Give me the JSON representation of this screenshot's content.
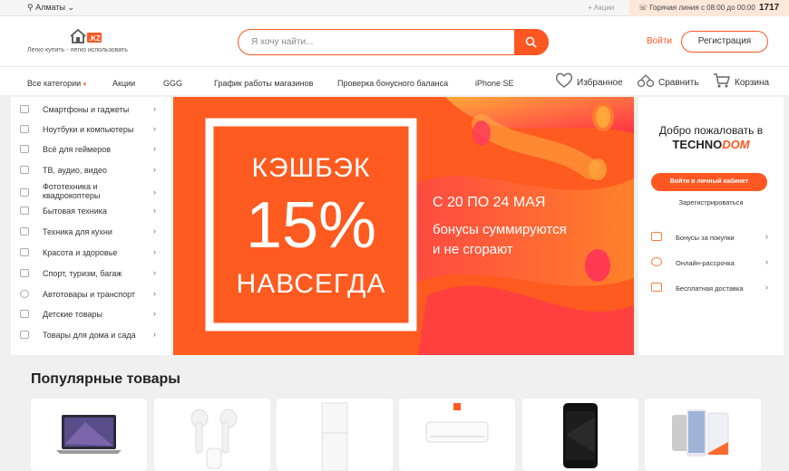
{
  "topbar": {
    "city": "Алматы",
    "promo_link": "+ Акции",
    "hotline_label": "Горячая линия с 08:00 до 00:00",
    "hotline_number": "1717"
  },
  "header": {
    "slogan": "Легко купить - легко использовать",
    "search_placeholder": "Я хочу найти...",
    "login": "Войти",
    "register": "Регистрация"
  },
  "nav": {
    "all_categories": "Все категории",
    "links": [
      "Акции",
      "GGG",
      "График работы магазинов",
      "Проверка бонусного баланса",
      "iPhone SE"
    ],
    "favorites": "Избранное",
    "compare": "Сравнить",
    "cart": "Корзина"
  },
  "sidebar": {
    "items": [
      "Смартфоны и гаджеты",
      "Ноутбуки и компьютеры",
      "Всё для геймеров",
      "ТВ, аудио, видео",
      "Фототехника и квадрокоптеры",
      "Бытовая техника",
      "Техника для кухни",
      "Красота и здоровье",
      "Спорт, туризм, багаж",
      "Автотовары и транспорт",
      "Детские товары",
      "Товары для дома и сада"
    ]
  },
  "banner": {
    "line1": "КЭШБЭК",
    "line2": "15%",
    "line3": "НАВСЕГДА",
    "dates": "С 20 ПО 24 МАЯ",
    "sub1": "бонусы суммируются",
    "sub2": "и не сгорают"
  },
  "welcome": {
    "title": "Добро пожаловать в",
    "brand_a": "TECHNO",
    "brand_b": "DOM",
    "cabinet_button": "Войти в личный кабинет",
    "register_link": "Зарегистрироваться",
    "benefits": [
      "Бонусы за покупки",
      "Онлайн-рассрочка",
      "Бесплатная доставка"
    ]
  },
  "popular": {
    "title": "Популярные товары"
  },
  "colors": {
    "accent": "#ff5722"
  }
}
